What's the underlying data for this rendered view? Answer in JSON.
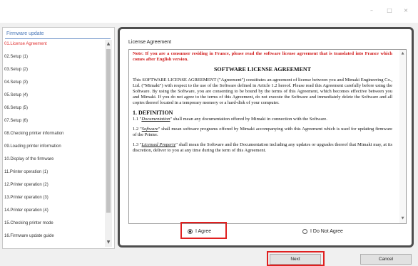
{
  "window": {
    "controls": {
      "minimize": "–",
      "maximize": "□",
      "close": "×"
    }
  },
  "sidebar": {
    "title": "Firmware update",
    "items": [
      {
        "label": "01.License Agreement",
        "active": true
      },
      {
        "label": "02.Setup (1)"
      },
      {
        "label": "03.Setup (2)"
      },
      {
        "label": "04.Setup (3)"
      },
      {
        "label": "05.Setup (4)"
      },
      {
        "label": "06.Setup (5)"
      },
      {
        "label": "07.Setup (6)"
      },
      {
        "label": "08.Checking printer information"
      },
      {
        "label": "09.Loading printer information"
      },
      {
        "label": "10.Display of the firmware"
      },
      {
        "label": "11.Printer operation (1)"
      },
      {
        "label": "12.Printer operation (2)"
      },
      {
        "label": "13.Printer operation (3)"
      },
      {
        "label": "14.Printer operation (4)"
      },
      {
        "label": "15.Checking printer mode"
      },
      {
        "label": "16.Firmware update guide"
      }
    ]
  },
  "panel": {
    "title": "License Agreement",
    "document": {
      "note": "Note: If you are a consumer residing in France, please read the software license agreement that is translated into France which comes after English version.",
      "heading": "SOFTWARE LICENSE AGREEMENT",
      "intro": "This SOFTWARE LICENSE AGREEMENT (\"Agreement\") constitutes an agreement of license between you and Mimaki Engineering Co., Ltd. (\"Mimaki\") with respect to the use of the Software defined in Article 1.2 hereof. Please read this Agreement carefully before using the Software. By using the Software, you are consenting to be bound by the terms of this Agreement, which becomes effective between you and Mimaki. If you do not agree to the terms of this Agreement, do not execute the Software and immediately delete the Software and all copies thereof located in a temporary memory or a hard-disk of your computer.",
      "section1_title": "1.  DEFINITION",
      "clause_1_1": {
        "num": "1.1 \"",
        "term": "Documentation",
        "text": "\" shall mean any documentation offered by Mimaki in connection with the Software."
      },
      "clause_1_2": {
        "num": "1.2 \"",
        "term": "Software",
        "text": "\" shall mean software programs offered by Mimaki accompanying with this Agreement which is used for updating firmware of the Printer."
      },
      "clause_1_3": {
        "num": "1.3 \"",
        "term": "Licensed Property",
        "text": "\" shall mean the Software and the Documentation including any updates or upgrades thereof that Mimaki may, at its discretion, deliver to you at any time during the term of this Agreement."
      }
    },
    "options": {
      "agree": "I Agree",
      "disagree": "I Do Not Agree",
      "selected": "agree"
    }
  },
  "buttons": {
    "next": "Next",
    "cancel": "Cancel"
  },
  "colors": {
    "active_step": "#e03030",
    "highlight": "#e02020",
    "note_text": "#d01818",
    "sidebar_title": "#4a78b8"
  }
}
